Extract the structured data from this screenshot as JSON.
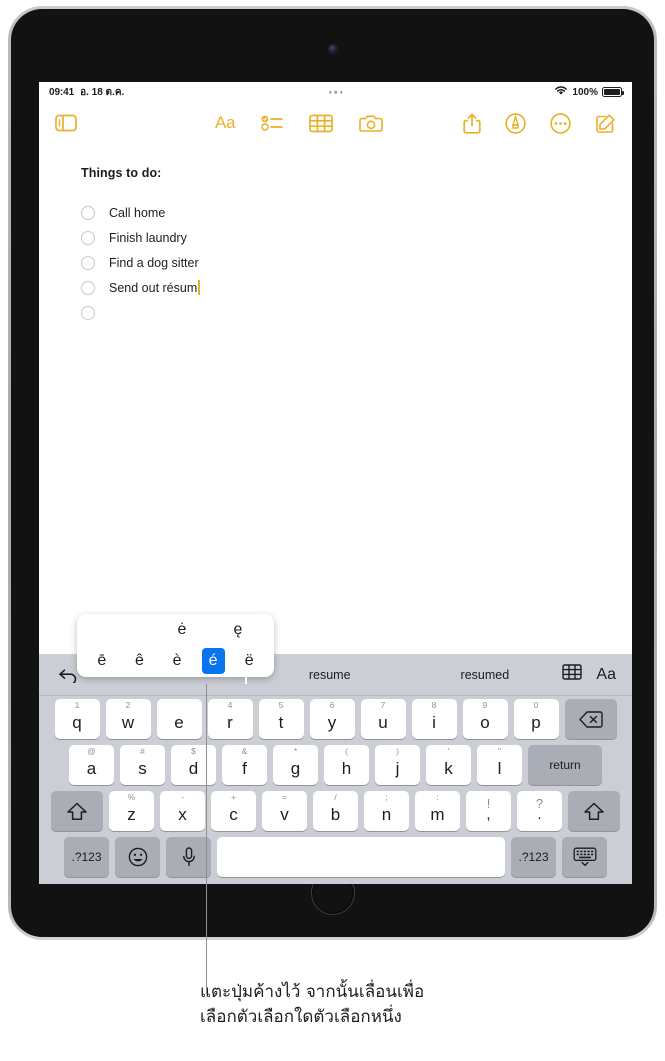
{
  "status_bar": {
    "time": "09:41",
    "date": "อ. 18 ต.ค.",
    "battery_percent": "100%",
    "wifi_icon": "wifi-icon",
    "battery_icon": "battery-icon",
    "multitask_icon": "multitask-dots-icon"
  },
  "toolbar": {
    "sidebar_icon": "sidebar-toggle-icon",
    "format_label": "Aa",
    "checklist_icon": "checklist-icon",
    "table_icon": "table-icon",
    "camera_icon": "camera-icon",
    "share_icon": "share-icon",
    "markup_icon": "markup-icon",
    "more_icon": "more-ellipsis-icon",
    "compose_icon": "compose-icon"
  },
  "note": {
    "title": "Things to do:",
    "items": [
      {
        "text": "Call home",
        "checked": false
      },
      {
        "text": "Finish laundry",
        "checked": false
      },
      {
        "text": "Find a dog sitter",
        "checked": false
      },
      {
        "text": "Send out résum",
        "checked": false,
        "has_caret": true
      },
      {
        "text": "",
        "checked": false
      }
    ]
  },
  "accent_popup": {
    "top_row": [
      "ė",
      "ę"
    ],
    "bottom_row": [
      "ē",
      "ê",
      "è",
      "é",
      "ë"
    ],
    "selected": "é",
    "selected_bg": "#0a74f0"
  },
  "predictive_bar": {
    "undo_icon": "undo-icon",
    "suggestions": [
      "resume",
      "resumed"
    ],
    "table_icon": "table-icon",
    "format_label": "Aa"
  },
  "keyboard": {
    "row1": [
      {
        "main": "q",
        "alt": "1"
      },
      {
        "main": "w",
        "alt": "2"
      },
      {
        "main": "e",
        "alt": ""
      },
      {
        "main": "r",
        "alt": "4"
      },
      {
        "main": "t",
        "alt": "5"
      },
      {
        "main": "y",
        "alt": "6"
      },
      {
        "main": "u",
        "alt": "7"
      },
      {
        "main": "i",
        "alt": "8"
      },
      {
        "main": "o",
        "alt": "9"
      },
      {
        "main": "p",
        "alt": "0"
      }
    ],
    "delete_icon": "delete-backspace-icon",
    "row2": [
      {
        "main": "a",
        "alt": "@"
      },
      {
        "main": "s",
        "alt": "#"
      },
      {
        "main": "d",
        "alt": "$"
      },
      {
        "main": "f",
        "alt": "&"
      },
      {
        "main": "g",
        "alt": "*"
      },
      {
        "main": "h",
        "alt": "("
      },
      {
        "main": "j",
        "alt": ")"
      },
      {
        "main": "k",
        "alt": "'"
      },
      {
        "main": "l",
        "alt": "\""
      }
    ],
    "return_label": "return",
    "row3": [
      {
        "main": "z",
        "alt": "%"
      },
      {
        "main": "x",
        "alt": "-"
      },
      {
        "main": "c",
        "alt": "+"
      },
      {
        "main": "v",
        "alt": "="
      },
      {
        "main": "b",
        "alt": "/"
      },
      {
        "main": "n",
        "alt": ";"
      },
      {
        "main": "m",
        "alt": ":"
      },
      {
        "main": ",",
        "alt": "!"
      },
      {
        "main": ".",
        "alt": "?"
      }
    ],
    "shift_icon": "shift-icon",
    "numeric_label": ".?123",
    "emoji_icon": "emoji-icon",
    "mic_icon": "microphone-icon",
    "dismiss_icon": "dismiss-keyboard-icon",
    "space_label": ""
  },
  "caption": {
    "line1": "แตะปุ่มค้างไว้ จากนั้นเลื่อนเพื่อ",
    "line2": "เลือกตัวเลือกใดตัวเลือกหนึ่ง"
  },
  "colors": {
    "accent": "#eab028",
    "selection_blue": "#0a74f0",
    "keyboard_bg": "#cbced4"
  }
}
